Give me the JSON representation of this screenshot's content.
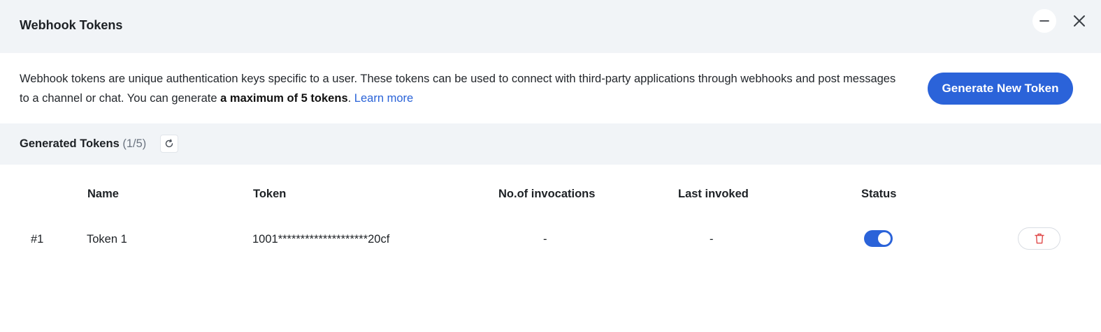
{
  "header": {
    "title": "Webhook Tokens",
    "minimize_icon": "minus-icon",
    "close_icon": "close-icon"
  },
  "intro": {
    "text_before": "Webhook tokens are unique authentication keys specific to a user. These tokens can be used to connect with third-party applications through webhooks and post messages to a channel or chat. You can generate ",
    "bold_text": "a maximum of 5 tokens",
    "text_after": ". ",
    "learn_more": "Learn more"
  },
  "generate_button": {
    "label": "Generate New Token"
  },
  "generated": {
    "label": "Generated Tokens",
    "count": "(1/5)",
    "refresh_icon": "refresh-icon"
  },
  "table": {
    "columns": {
      "name": "Name",
      "token": "Token",
      "invocations": "No.of invocations",
      "last_invoked": "Last invoked",
      "status": "Status"
    },
    "rows": [
      {
        "index": "#1",
        "name": "Token 1",
        "token": "1001********************20cf",
        "invocations": "-",
        "last_invoked": "-",
        "status_enabled": true,
        "delete_icon": "trash-icon"
      }
    ]
  },
  "colors": {
    "accent": "#2b63d9",
    "link": "#2a63d8",
    "danger": "#e04a4a",
    "panel_bg": "#f1f4f7"
  }
}
